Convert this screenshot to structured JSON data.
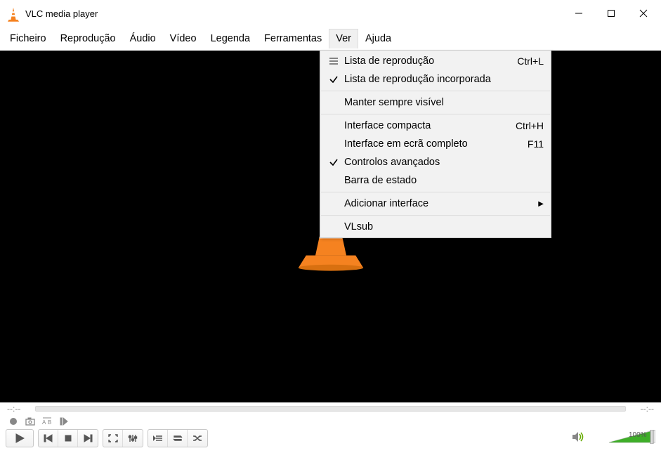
{
  "window": {
    "title": "VLC media player"
  },
  "menubar": {
    "items": [
      "Ficheiro",
      "Reprodução",
      "Áudio",
      "Vídeo",
      "Legenda",
      "Ferramentas",
      "Ver",
      "Ajuda"
    ],
    "open_index": 6
  },
  "dropdown": {
    "groups": [
      [
        {
          "icon": "playlist",
          "label": "Lista de reprodução",
          "accel": "Ctrl+L"
        },
        {
          "icon": "check",
          "label": "Lista de reprodução incorporada",
          "accel": ""
        }
      ],
      [
        {
          "icon": "",
          "label": "Manter sempre visível",
          "accel": ""
        }
      ],
      [
        {
          "icon": "",
          "label": "Interface compacta",
          "accel": "Ctrl+H"
        },
        {
          "icon": "",
          "label": "Interface em ecrã completo",
          "accel": "F11"
        },
        {
          "icon": "check",
          "label": "Controlos avançados",
          "accel": ""
        },
        {
          "icon": "",
          "label": "Barra de estado",
          "accel": ""
        }
      ],
      [
        {
          "icon": "",
          "label": "Adicionar interface",
          "accel": "",
          "submenu": true
        }
      ],
      [
        {
          "icon": "",
          "label": "VLsub",
          "accel": ""
        }
      ]
    ]
  },
  "seek": {
    "left_time": "--:--",
    "right_time": "--:--"
  },
  "volume": {
    "text": "100%"
  }
}
